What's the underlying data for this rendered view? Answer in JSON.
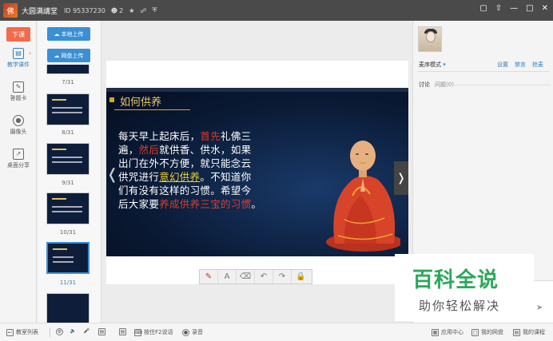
{
  "titlebar": {
    "app_title": "大圆满講堂",
    "room_id": "ID 95337230",
    "user_count": "2",
    "icons": [
      "user-icon",
      "star-icon",
      "link-icon",
      "shield-icon"
    ],
    "window_icons": [
      "minimize-icon",
      "pin-icon",
      "restore-icon",
      "close-icon"
    ]
  },
  "leftnav": {
    "end_class": "下课",
    "items": [
      {
        "label": "教学课件",
        "icon": "courseware-icon",
        "active": true
      },
      {
        "label": "答题卡",
        "icon": "answer-card-icon",
        "active": false
      },
      {
        "label": "摄像头",
        "icon": "camera-icon",
        "active": false
      },
      {
        "label": "桌面分享",
        "icon": "desktop-share-icon",
        "active": false
      }
    ]
  },
  "thumbpanel": {
    "local_upload": "本地上传",
    "cloud_upload": "网盘上传",
    "pages": [
      "7/31",
      "8/31",
      "9/31",
      "10/31",
      "11/31"
    ],
    "active_page": "11/31"
  },
  "slide": {
    "title": "如何供养",
    "lines": [
      [
        {
          "t": "每天早上起床后，",
          "c": "w"
        },
        {
          "t": "首先",
          "c": "r"
        },
        {
          "t": "礼佛三",
          "c": "w"
        }
      ],
      [
        {
          "t": "遍，",
          "c": "w"
        },
        {
          "t": "然后",
          "c": "r"
        },
        {
          "t": "就供香、供水，如果",
          "c": "w"
        }
      ],
      [
        {
          "t": "出门在外不方便，就只能念云",
          "c": "w"
        }
      ],
      [
        {
          "t": "供咒进行",
          "c": "w"
        },
        {
          "t": "意幻供养",
          "c": "y"
        },
        {
          "t": "。不知道你",
          "c": "w"
        }
      ],
      [
        {
          "t": "们有没有这样的习惯。希望今",
          "c": "w"
        }
      ],
      [
        {
          "t": "后大家要",
          "c": "w"
        },
        {
          "t": "养成供养三宝的习惯",
          "c": "r"
        },
        {
          "t": "。",
          "c": "w"
        }
      ]
    ]
  },
  "toolbar": {
    "tools": [
      "pen-icon",
      "text-icon",
      "eraser-icon",
      "undo-icon",
      "redo-icon",
      "lock-icon"
    ],
    "text_glyph": "A"
  },
  "rightpanel": {
    "mode_label": "麦序模式",
    "links": [
      "设置",
      "禁言",
      "抢麦"
    ],
    "tab_discuss": "讨论",
    "tab_question": "问题",
    "question_count": "0"
  },
  "watermark": {
    "main": "百科全说",
    "sub": "助你轻松解决"
  },
  "statusbar": {
    "classroom_list": "教室列表",
    "push_to_talk": "按住F2说话",
    "record": "录音",
    "app_center": "应用中心",
    "my_drive": "我的网盘",
    "my_course": "我的课程"
  }
}
